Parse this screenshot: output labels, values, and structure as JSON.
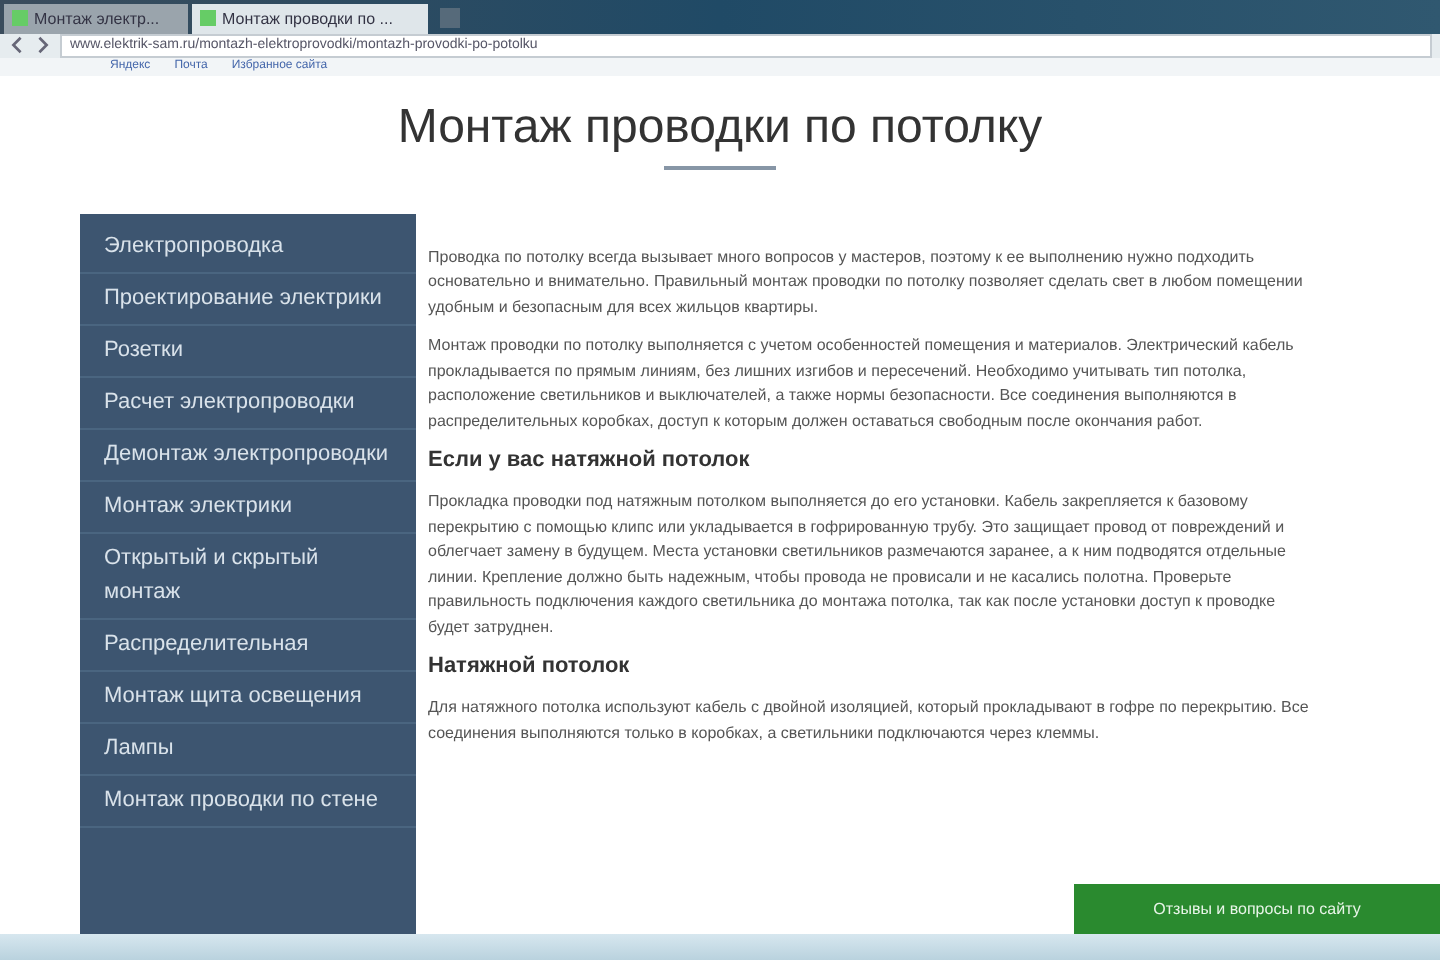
{
  "browser": {
    "tabs": [
      {
        "label": "Монтаж электр...",
        "selected": false
      },
      {
        "label": "Монтаж проводки по ...",
        "selected": true
      }
    ],
    "address": "www.elektrik-sam.ru/montazh-elektroprovodki/montazh-provodki-po-potolku",
    "bookmarks": [
      "Яндекс",
      "Почта",
      "Избранное сайта"
    ]
  },
  "page": {
    "title": "Монтаж проводки по потолку",
    "sidebar": [
      {
        "label": "Электропроводка"
      },
      {
        "label": "Проектирование электрики"
      },
      {
        "label": "Розетки"
      },
      {
        "label": "Расчет электропроводки"
      },
      {
        "label": "Демонтаж электропроводки"
      },
      {
        "label": "Монтаж электрики"
      },
      {
        "label": "Открытый и скрытый монтаж"
      },
      {
        "label": "Распределительная"
      },
      {
        "label": "Монтаж щита освещения"
      },
      {
        "label": "Лампы"
      },
      {
        "label": "Монтаж проводки по стене"
      }
    ],
    "content": [
      {
        "kind": "paragraph",
        "text": "Проводка по потолку всегда вызывает много вопросов у мастеров, поэтому к ее выполнению нужно подходить основательно и внимательно. Правильный монтаж проводки по потолку позволяет сделать свет в любом помещении удобным и безопасным для всех жильцов квартиры."
      },
      {
        "kind": "paragraph",
        "text": "Монтаж проводки по потолку выполняется с учетом особенностей помещения и материалов. Электрический кабель прокладывается по прямым линиям, без лишних изгибов и пересечений. Необходимо учитывать тип потолка, расположение светильников и выключателей, а также нормы безопасности. Все соединения выполняются в распределительных коробках, доступ к которым должен оставаться свободным после окончания работ."
      },
      {
        "kind": "heading",
        "text": "Если у вас натяжной потолок"
      },
      {
        "kind": "paragraph",
        "text": "Прокладка проводки под натяжным потолком выполняется до его установки. Кабель закрепляется к базовому перекрытию с помощью клипс или укладывается в гофрированную трубу. Это защищает провод от повреждений и облегчает замену в будущем. Места установки светильников размечаются заранее, а к ним подводятся отдельные линии. Крепление должно быть надежным, чтобы провода не провисали и не касались полотна. Проверьте правильность подключения каждого светильника до монтажа потолка, так как после установки доступ к проводке будет затруднен."
      },
      {
        "kind": "heading",
        "text": "Натяжной потолок"
      },
      {
        "kind": "paragraph",
        "text": "Для натяжного потолка используют кабель с двойной изоляцией, который прокладывают в гофре по перекрытию. Все соединения выполняются только в коробках, а светильники подключаются через клеммы."
      }
    ],
    "feedback_button": "Отзывы и вопросы по сайту"
  }
}
